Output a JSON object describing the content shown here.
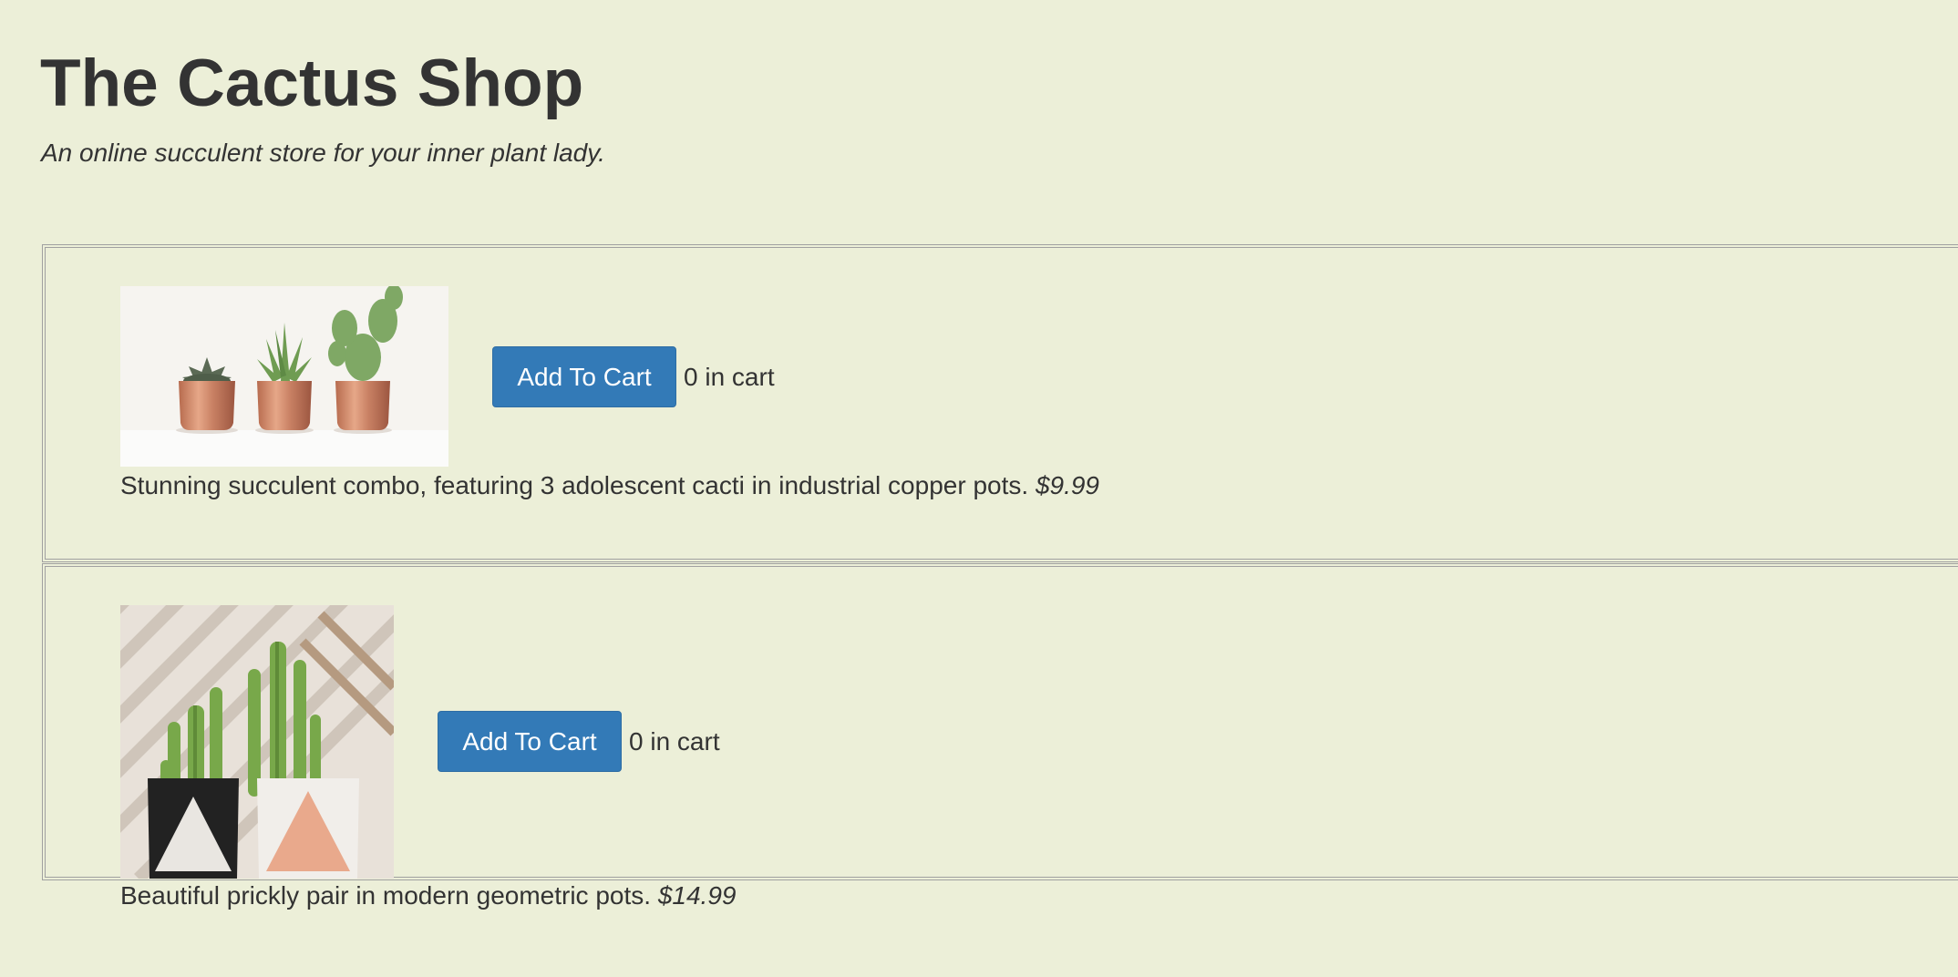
{
  "header": {
    "title": "The Cactus Shop",
    "tagline": "An online succulent store for your inner plant lady."
  },
  "products": [
    {
      "image_name": "three-cacti-copper-pots-image",
      "add_button_label": "Add To Cart",
      "cart_count": "0 in cart",
      "description": "Stunning succulent combo, featuring 3 adolescent cacti in industrial copper pots.",
      "price": "$9.99"
    },
    {
      "image_name": "prickly-pair-geometric-pots-image",
      "add_button_label": "Add To Cart",
      "cart_count": "0 in cart",
      "description": "Beautiful prickly pair in modern geometric pots.",
      "price": "$14.99"
    }
  ],
  "colors": {
    "background": "#ecefd8",
    "button": "#337ab7",
    "text": "#333333",
    "border": "#a0a0a0"
  }
}
